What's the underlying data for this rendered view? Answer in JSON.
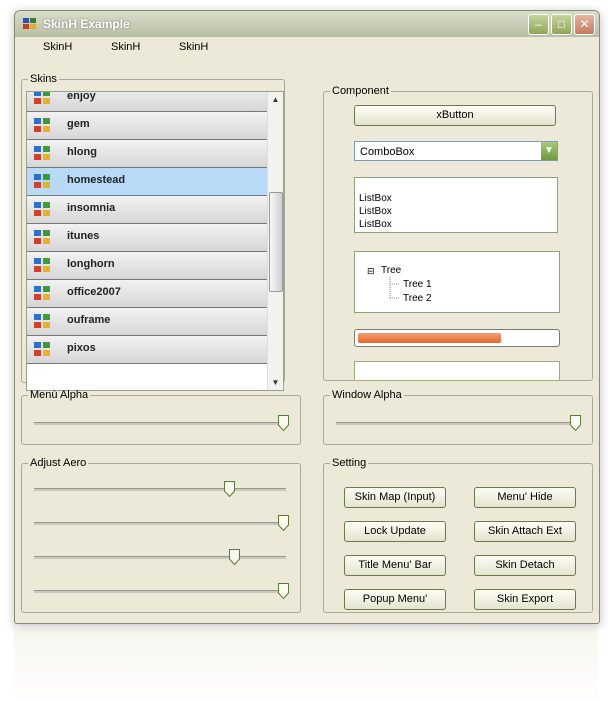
{
  "window": {
    "title": "SkinH Example"
  },
  "menu": [
    "SkinH",
    "SkinH",
    "SkinH"
  ],
  "skins": {
    "legend": "Skins",
    "selected_index": 3,
    "items": [
      "enjoy",
      "gem",
      "hlong",
      "homestead",
      "insomnia",
      "itunes",
      "longhorn",
      "office2007",
      "ouframe",
      "pixos"
    ]
  },
  "component": {
    "legend": "Component",
    "xbutton": "xButton",
    "combobox": "ComboBox",
    "listbox": [
      "ListBox",
      "ListBox",
      "ListBox"
    ],
    "tree": {
      "root": "Tree",
      "children": [
        "Tree 1",
        "Tree 2"
      ],
      "expander": "⊟"
    },
    "progress": 0.72
  },
  "menu_alpha": {
    "legend": "Menù Alpha",
    "value": 1.0
  },
  "window_alpha": {
    "legend": "Window Alpha",
    "value": 1.0
  },
  "adjust_aero": {
    "legend": "Adjust Aero",
    "values": [
      0.78,
      1.0,
      0.8,
      1.0
    ]
  },
  "setting": {
    "legend": "Setting",
    "buttons": [
      "Skin Map (Input)",
      "Menu' Hide",
      "Lock Update",
      "Skin Attach Ext",
      "Title Menu' Bar",
      "Skin Detach",
      "Popup Menu'",
      "Skin Export"
    ]
  },
  "colors": {
    "selected_row": "#b8daf6",
    "progress_fill": "#e0692e",
    "titlebar": "#b8bea4"
  }
}
